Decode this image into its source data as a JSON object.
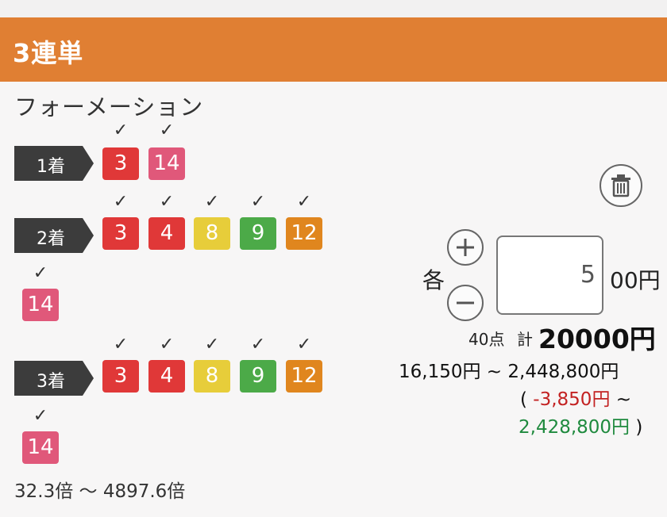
{
  "bet_type": "3連単",
  "mode": "フォーメーション",
  "rows": [
    {
      "label": "1着",
      "chips": [
        {
          "number": "3",
          "color": "#e03838",
          "checked": true
        },
        {
          "number": "14",
          "color": "#e0587a",
          "checked": true
        }
      ]
    },
    {
      "label": "2着",
      "chips": [
        {
          "number": "3",
          "color": "#e03838",
          "checked": true
        },
        {
          "number": "4",
          "color": "#e03838",
          "checked": true
        },
        {
          "number": "8",
          "color": "#e7cd3a",
          "checked": true
        },
        {
          "number": "9",
          "color": "#4caa48",
          "checked": true
        },
        {
          "number": "12",
          "color": "#e0861e",
          "checked": true
        },
        {
          "number": "14",
          "color": "#e0587a",
          "checked": true
        }
      ]
    },
    {
      "label": "3着",
      "chips": [
        {
          "number": "3",
          "color": "#e03838",
          "checked": true
        },
        {
          "number": "4",
          "color": "#e03838",
          "checked": true
        },
        {
          "number": "8",
          "color": "#e7cd3a",
          "checked": true
        },
        {
          "number": "9",
          "color": "#4caa48",
          "checked": true
        },
        {
          "number": "12",
          "color": "#e0861e",
          "checked": true
        },
        {
          "number": "14",
          "color": "#e0587a",
          "checked": true
        }
      ]
    }
  ],
  "check_mark": "✓",
  "odds_range": "32.3倍 〜 4897.6倍",
  "each_label": "各",
  "amount_value": "5",
  "amount_unit": "00円",
  "points": "40点",
  "total_label": "計",
  "total_value": "20000円",
  "payout_range": "16,150円 ~ 2,448,800円",
  "profit": {
    "open": "(",
    "min": "-3,850円",
    "sep": "~",
    "max": "2,428,800円",
    "close": ")"
  },
  "colors": {
    "header_bg": "#e07f33",
    "row_label_bg": "#3c3c3c",
    "negative": "#c32222",
    "positive": "#1f8a3e"
  },
  "icons": {
    "trash": "trash-icon",
    "plus": "plus-icon",
    "minus": "minus-icon",
    "check": "check-icon"
  }
}
